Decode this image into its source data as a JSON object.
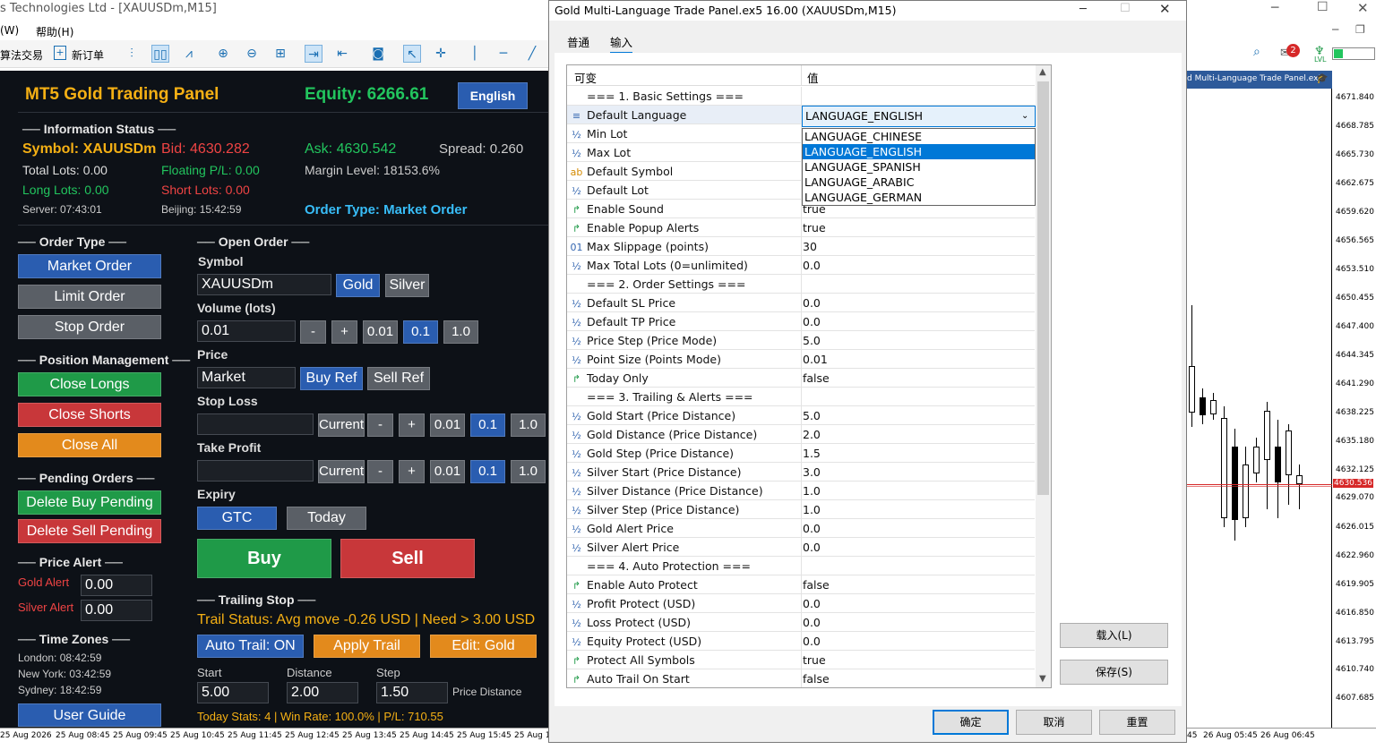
{
  "app": {
    "title": "s Technologies Ltd - [XAUUSDm,M15]",
    "menu": [
      "(W)",
      "帮助(H)"
    ],
    "algo_label": "算法交易",
    "new_order_label": "新订单"
  },
  "chart": {
    "tab_title": "d Multi-Language Trade Panel.ex5",
    "last_price": "4630.536",
    "price_labels": [
      "4671.840",
      "4668.785",
      "4665.730",
      "4662.675",
      "4659.620",
      "4656.565",
      "4653.510",
      "4650.455",
      "4647.400",
      "4644.345",
      "4641.290",
      "4638.225",
      "4635.180",
      "4632.125",
      "4629.070",
      "4626.015",
      "4622.960",
      "4619.905",
      "4616.850",
      "4613.795",
      "4610.740",
      "4607.685"
    ],
    "time_labels": [
      "25 Aug 2026",
      "25 Aug 08:45",
      "25 Aug 09:45",
      "25 Aug 10:45",
      "25 Aug 11:45",
      "25 Aug 12:45",
      "25 Aug 13:45",
      "25 Aug 14:45",
      "25 Aug 15:45",
      "25 Aug 1"
    ],
    "time_labels_right": [
      "45",
      "26 Aug 05:45",
      "26 Aug 06:45"
    ],
    "notif_count": "2",
    "lvl_label": "LVL"
  },
  "panel": {
    "title": "MT5 Gold Trading Panel",
    "equity": "Equity: 6266.61",
    "lang_btn": "English",
    "info_header": "── Information Status ──",
    "symbol": "Symbol: XAUUSDm",
    "bid": "Bid: 4630.282",
    "ask": "Ask: 4630.542",
    "spread": "Spread: 0.260",
    "total_lots": "Total Lots: 0.00",
    "floating": "Floating P/L: 0.00",
    "margin": "Margin Level: 18153.6%",
    "long_lots": "Long Lots: 0.00",
    "short_lots": "Short Lots: 0.00",
    "server": "Server: 07:43:01",
    "beijing": "Beijing: 15:42:59",
    "order_type_status": "Order Type: Market Order",
    "order_type_header": "── Order Type ──",
    "market_order": "Market Order",
    "limit_order": "Limit Order",
    "stop_order": "Stop Order",
    "pos_header": "── Position Management ──",
    "close_longs": "Close Longs",
    "close_shorts": "Close Shorts",
    "close_all": "Close All",
    "pending_header": "── Pending Orders ──",
    "del_buy": "Delete Buy Pending",
    "del_sell": "Delete Sell Pending",
    "alert_header": "── Price Alert ──",
    "gold_alert": "Gold Alert",
    "gold_alert_val": "0.00",
    "silver_alert": "Silver Alert",
    "silver_alert_val": "0.00",
    "tz_header": "── Time Zones ──",
    "london": "London: 08:42:59",
    "newyork": "New York: 03:42:59",
    "sydney": "Sydney: 18:42:59",
    "user_guide": "User Guide",
    "open_header": "── Open Order ──",
    "symbol_label": "Symbol",
    "symbol_val": "XAUUSDm",
    "gold_btn": "Gold",
    "silver_btn": "Silver",
    "volume_label": "Volume (lots)",
    "volume_val": "0.01",
    "minus": "-",
    "plus": "+",
    "v001": "0.01",
    "v01": "0.1",
    "v10": "1.0",
    "price_label": "Price",
    "price_val": "Market",
    "buy_ref": "Buy Ref",
    "sell_ref": "Sell Ref",
    "sl_label": "Stop Loss",
    "tp_label": "Take Profit",
    "current": "Current",
    "expiry_label": "Expiry",
    "gtc": "GTC",
    "today": "Today",
    "buy": "Buy",
    "sell": "Sell",
    "trail_header": "── Trailing Stop ──",
    "trail_status": "Trail Status: Avg move -0.26 USD | Need > 3.00 USD",
    "auto_trail": "Auto Trail: ON",
    "apply_trail": "Apply Trail",
    "edit_gold": "Edit: Gold",
    "start_label": "Start",
    "distance_label": "Distance",
    "step_label": "Step",
    "start_val": "5.00",
    "distance_val": "2.00",
    "step_val": "1.50",
    "price_distance": "Price Distance",
    "today_stats": "Today Stats: 4 | Win Rate: 100.0% | P/L: 710.55"
  },
  "dialog": {
    "title": "Gold Multi-Language Trade Panel.ex5 16.00 (XAUUSDm,M15)",
    "tabs": [
      "普通",
      "输入"
    ],
    "col_var": "可变",
    "col_val": "值",
    "rows": [
      {
        "icon": "",
        "name": "=== 1. Basic Settings ===",
        "value": ""
      },
      {
        "icon": "≡",
        "name": "Default Language",
        "value": ""
      },
      {
        "icon": "½",
        "name": "Min Lot",
        "value": ""
      },
      {
        "icon": "½",
        "name": "Max Lot",
        "value": ""
      },
      {
        "icon": "ab",
        "name": "Default Symbol",
        "value": ""
      },
      {
        "icon": "½",
        "name": "Default Lot",
        "value": ""
      },
      {
        "icon": "↱",
        "name": "Enable Sound",
        "value": "true"
      },
      {
        "icon": "↱",
        "name": "Enable Popup Alerts",
        "value": "true"
      },
      {
        "icon": "01",
        "name": "Max Slippage (points)",
        "value": "30"
      },
      {
        "icon": "½",
        "name": "Max Total Lots (0=unlimited)",
        "value": "0.0"
      },
      {
        "icon": "",
        "name": "=== 2. Order Settings ===",
        "value": ""
      },
      {
        "icon": "½",
        "name": "Default SL Price",
        "value": "0.0"
      },
      {
        "icon": "½",
        "name": "Default TP Price",
        "value": "0.0"
      },
      {
        "icon": "½",
        "name": "Price Step (Price Mode)",
        "value": "5.0"
      },
      {
        "icon": "½",
        "name": "Point Size (Points Mode)",
        "value": "0.01"
      },
      {
        "icon": "↱",
        "name": "Today Only",
        "value": "false"
      },
      {
        "icon": "",
        "name": "=== 3. Trailing & Alerts ===",
        "value": ""
      },
      {
        "icon": "½",
        "name": "Gold Start (Price Distance)",
        "value": "5.0"
      },
      {
        "icon": "½",
        "name": "Gold Distance (Price Distance)",
        "value": "2.0"
      },
      {
        "icon": "½",
        "name": "Gold Step (Price Distance)",
        "value": "1.5"
      },
      {
        "icon": "½",
        "name": "Silver Start (Price Distance)",
        "value": "3.0"
      },
      {
        "icon": "½",
        "name": "Silver Distance (Price Distance)",
        "value": "1.0"
      },
      {
        "icon": "½",
        "name": "Silver Step (Price Distance)",
        "value": "1.0"
      },
      {
        "icon": "½",
        "name": "Gold Alert Price",
        "value": "0.0"
      },
      {
        "icon": "½",
        "name": "Silver Alert Price",
        "value": "0.0"
      },
      {
        "icon": "",
        "name": "=== 4. Auto Protection ===",
        "value": ""
      },
      {
        "icon": "↱",
        "name": "Enable Auto Protect",
        "value": "false"
      },
      {
        "icon": "½",
        "name": "Profit Protect (USD)",
        "value": "0.0"
      },
      {
        "icon": "½",
        "name": "Loss Protect (USD)",
        "value": "0.0"
      },
      {
        "icon": "½",
        "name": "Equity Protect (USD)",
        "value": "0.0"
      },
      {
        "icon": "↱",
        "name": "Protect All Symbols",
        "value": "true"
      },
      {
        "icon": "↱",
        "name": "Auto Trail On Start",
        "value": "false"
      }
    ],
    "select_value": "LANGUAGE_ENGLISH",
    "options": [
      "LANGUAGE_CHINESE",
      "LANGUAGE_ENGLISH",
      "LANGUAGE_SPANISH",
      "LANGUAGE_ARABIC",
      "LANGUAGE_GERMAN"
    ],
    "load_btn": "载入(L)",
    "save_btn": "保存(S)",
    "ok_btn": "确定",
    "cancel_btn": "取消",
    "reset_btn": "重置"
  },
  "colors": {
    "panel_bg": "#0d1117",
    "green_text": "#22c55e",
    "red_text": "#ef4444",
    "gold_text": "#f5b014",
    "blue_btn": "#2a5db0",
    "gray_btn": "#5a5f66",
    "green_btn": "#1f9a48",
    "red_btn": "#c8373a",
    "orange_btn": "#e38a1c"
  }
}
